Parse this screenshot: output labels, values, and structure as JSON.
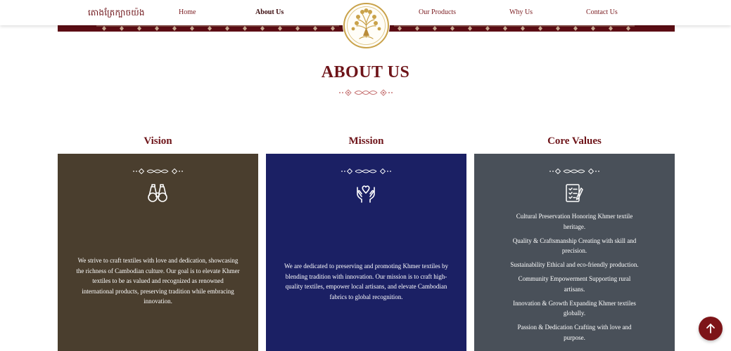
{
  "header": {
    "brand_name": "តោងត្រែក្បាចយ៉ង",
    "nav": [
      {
        "label": "Home"
      },
      {
        "label": "About Us"
      },
      {
        "label": "Our Products"
      },
      {
        "label": "Why Us"
      },
      {
        "label": "Contact Us"
      }
    ],
    "active_nav": "About Us"
  },
  "section": {
    "title": "ABOUT US"
  },
  "cards": [
    {
      "heading": "Vision",
      "icon": "binoculars-icon",
      "bg_color": "#4a3e2e",
      "text": "We strive to craft textiles with love and dedication, showcasing the richness of Cambodian culture. Our goal is to elevate Khmer textiles to be as valued and recognized as renowned international products, preserving tradition while embracing innovation."
    },
    {
      "heading": "Mission",
      "icon": "hands-heart-icon",
      "bg_color": "#1b2064",
      "text": "We are dedicated to preserving and promoting Khmer textiles by blending tradition with innovation. Our mission is to craft high-quality textiles, empower local artisans, and elevate Cambodian fabrics to global recognition."
    },
    {
      "heading": "Core Values",
      "icon": "checklist-icon",
      "bg_color": "#495059",
      "values": [
        "Cultural Preservation Honoring Khmer textile heritage.",
        "Quality & Craftsmanship Creating with skill and precision.",
        "Sustainability Ethical and eco-friendly production.",
        "Community Empowerment Supporting rural artisans.",
        "Innovation & Growth Expanding Khmer textiles globally.",
        "Passion & Dedication Crafting with love and purpose."
      ]
    }
  ],
  "colors": {
    "brand": "#6e1419",
    "band": "#5c0d14",
    "gold": "#c9a24a",
    "scroll_button": "#7d1418"
  },
  "scroll_top_icon": "arrow-up-icon"
}
